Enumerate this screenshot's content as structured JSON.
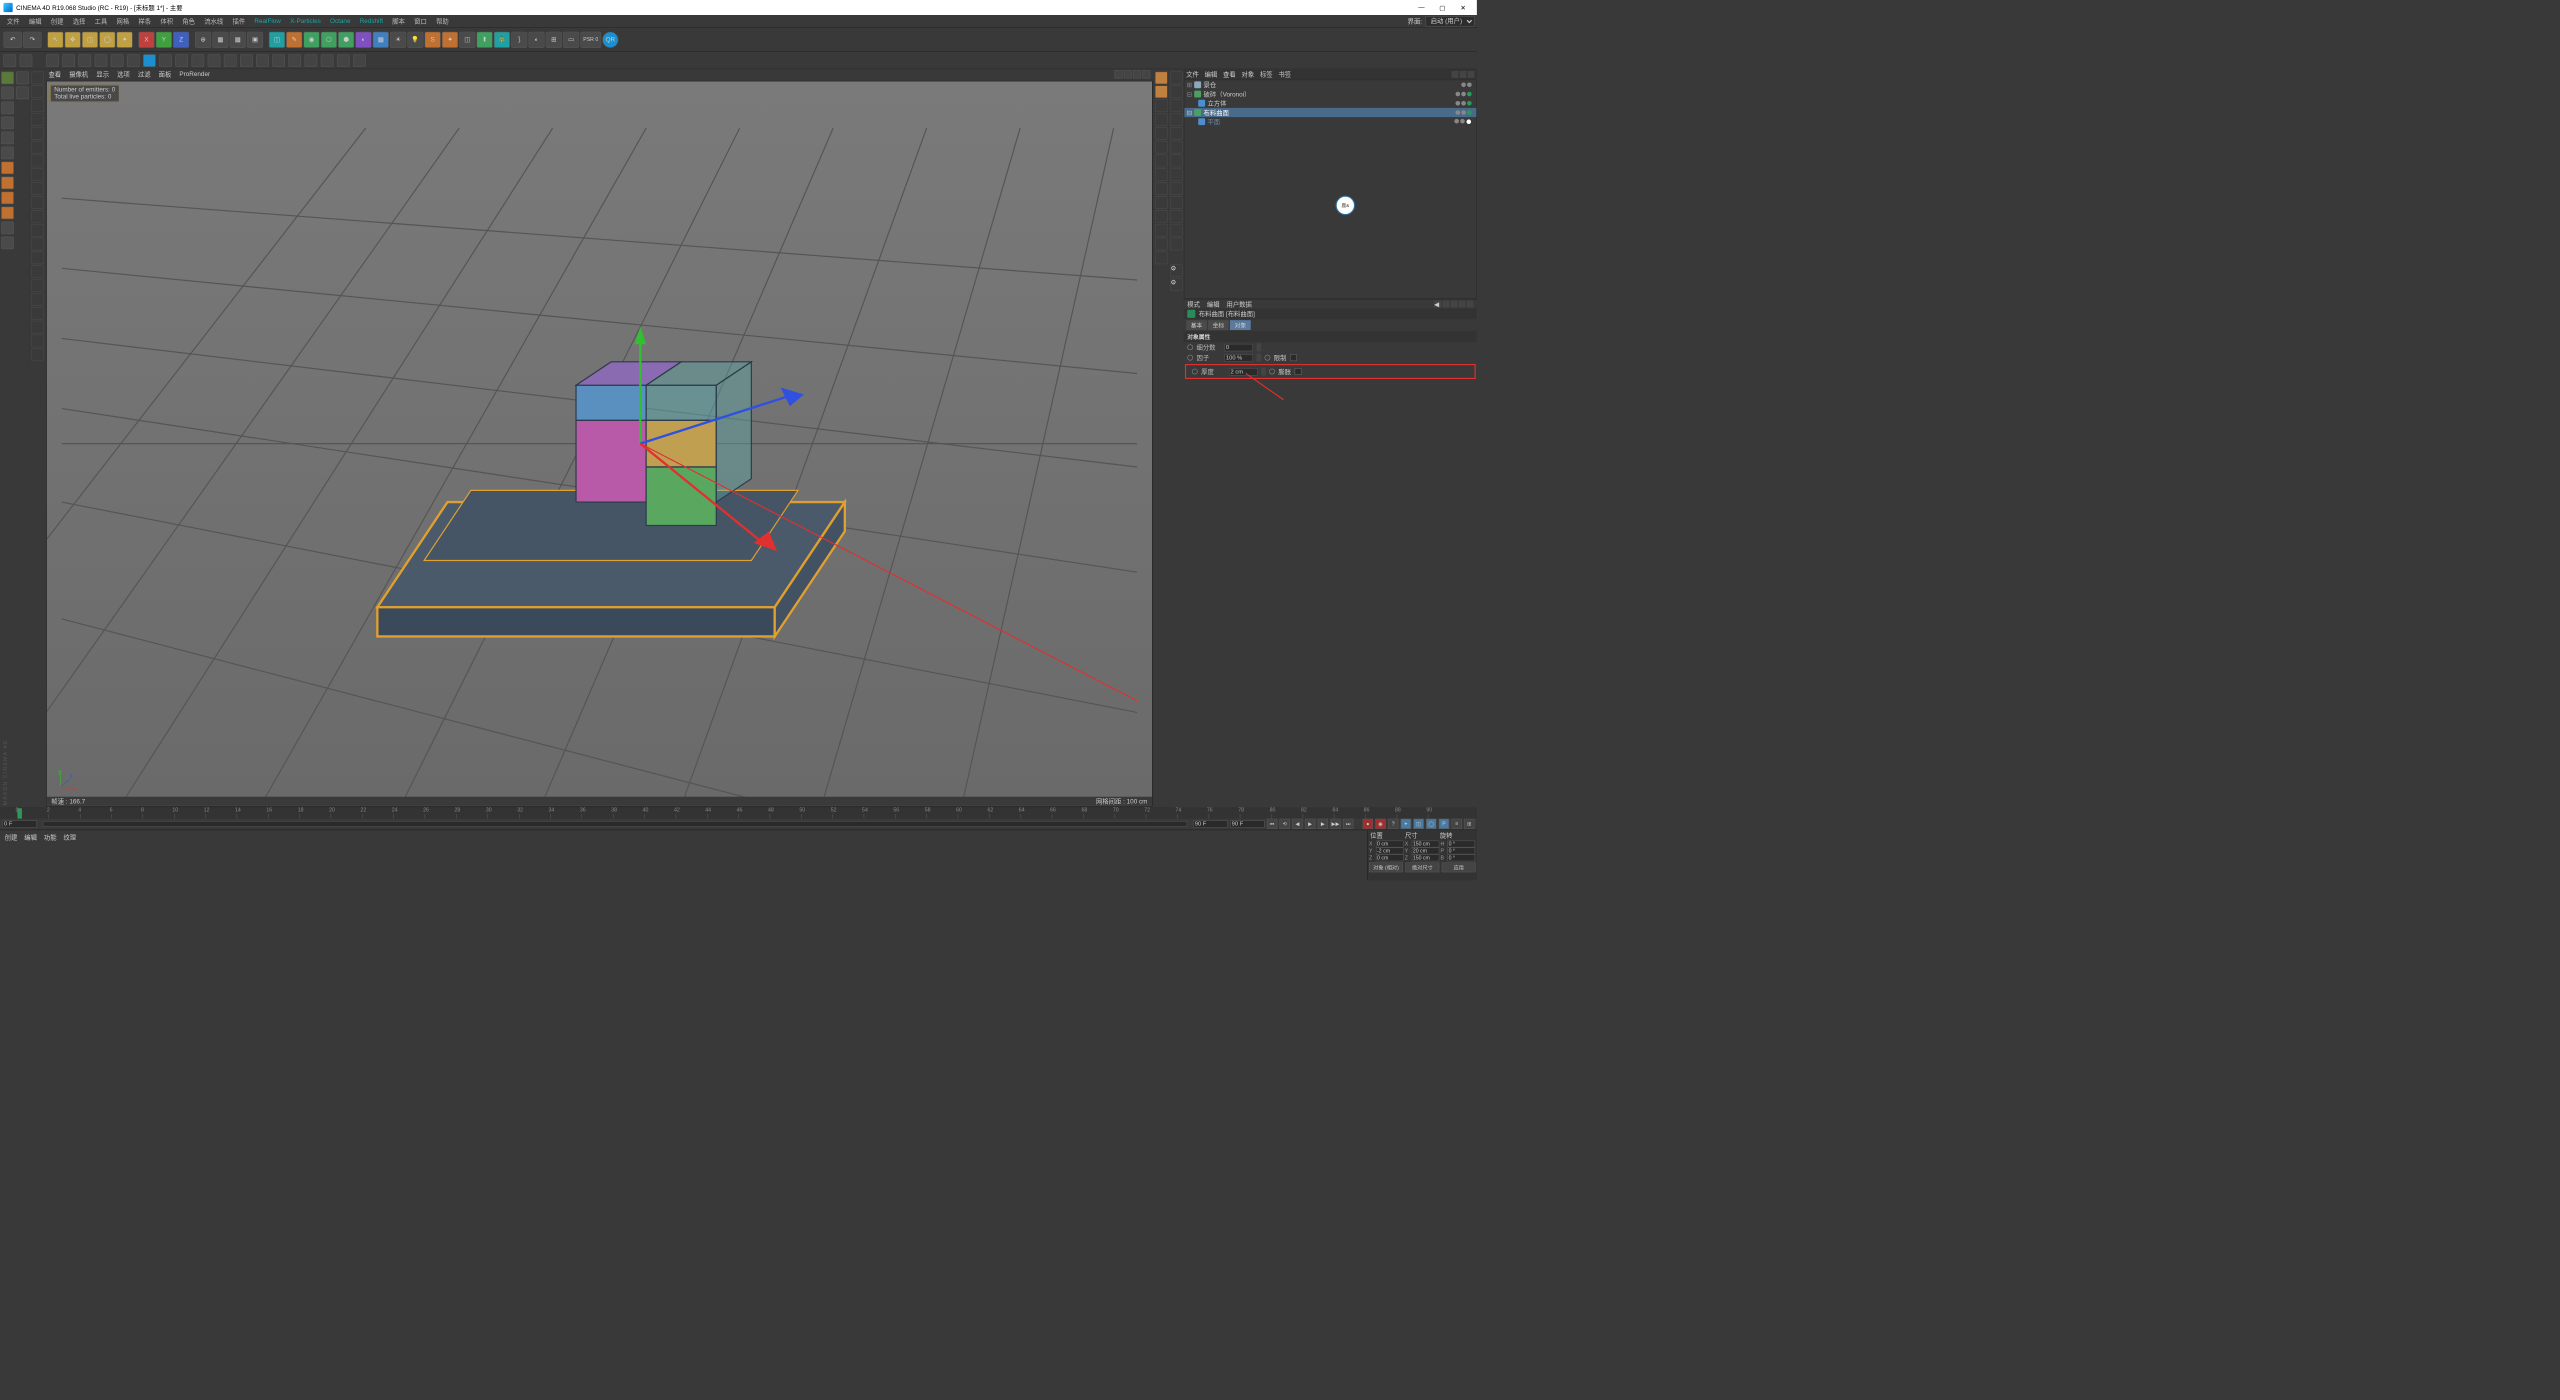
{
  "title": "CINEMA 4D R19.068 Studio (RC - R19) - [未标题 1*] - 主要",
  "menu": [
    "文件",
    "编辑",
    "创建",
    "选择",
    "工具",
    "网格",
    "样条",
    "体积",
    "角色",
    "流水线",
    "插件",
    "RealFlow",
    "X-Particles",
    "Octane",
    "Redshift",
    "脚本",
    "窗口",
    "帮助"
  ],
  "menu_right": {
    "label": "界面:",
    "value": "启动 (用户)"
  },
  "viewmenu": [
    "查看",
    "摄像机",
    "显示",
    "选项",
    "过滤",
    "面板",
    "ProRender"
  ],
  "overlay": {
    "emitters": "Number of emitters: 0",
    "particles": "Total live particles: 0"
  },
  "view_status": {
    "left": "帧速 : 166.7",
    "right": "网格间距 : 100 cm"
  },
  "obj_tabs": [
    "文件",
    "编辑",
    "查看",
    "对象",
    "标签",
    "书签"
  ],
  "objects": [
    {
      "name": "景仓",
      "indent": 0,
      "icon": "#8aa8c0"
    },
    {
      "name": "破碎（Voronoi）",
      "indent": 0,
      "icon": "#4aa060"
    },
    {
      "name": "立方体",
      "indent": 1,
      "icon": "#4a90d0"
    },
    {
      "name": "布料曲面",
      "indent": 0,
      "icon": "#4aa060",
      "sel": true
    },
    {
      "name": "平面",
      "indent": 1,
      "icon": "#4a90d0"
    }
  ],
  "attr_tabs": [
    "模式",
    "编辑",
    "用户数据"
  ],
  "attr_obj": "布料曲面 [布料曲面]",
  "attr_subtabs": [
    "基本",
    "坐标",
    "对象"
  ],
  "attr_section": "对象属性",
  "props": {
    "subdiv": {
      "label": "细分数",
      "value": "0"
    },
    "factor": {
      "label": "因子",
      "value": "100 %",
      "check_label": "限制"
    },
    "thick": {
      "label": "厚度",
      "value": "2 cm",
      "check_label": "膨胀"
    }
  },
  "timeline": {
    "start": "0 F",
    "end": "90 F",
    "end2": "90 F",
    "ticks": [
      0,
      2,
      4,
      6,
      8,
      10,
      12,
      14,
      16,
      18,
      20,
      22,
      24,
      26,
      28,
      30,
      32,
      34,
      36,
      38,
      40,
      42,
      44,
      46,
      48,
      50,
      52,
      54,
      56,
      58,
      60,
      62,
      64,
      66,
      68,
      70,
      72,
      74,
      76,
      78,
      80,
      82,
      84,
      86,
      88,
      90
    ]
  },
  "mat_tabs": [
    "创建",
    "编辑",
    "功能",
    "纹理"
  ],
  "coords": {
    "headers": [
      "位置",
      "尺寸",
      "旋转"
    ],
    "rows": [
      {
        "axis": "X",
        "p": "0 cm",
        "s": "150 cm",
        "rlabel": "H",
        "r": "0 °"
      },
      {
        "axis": "Y",
        "p": "-2 cm",
        "s": "20 cm",
        "rlabel": "P",
        "r": "0 °"
      },
      {
        "axis": "Z",
        "p": "0 cm",
        "s": "150 cm",
        "rlabel": "B",
        "r": "0 °"
      }
    ],
    "btns": [
      "对象 (相对)",
      "绝对尺寸",
      "应用"
    ]
  },
  "psr": "PSR\n0",
  "maxon": "MAXON\nCINEMA 4D"
}
